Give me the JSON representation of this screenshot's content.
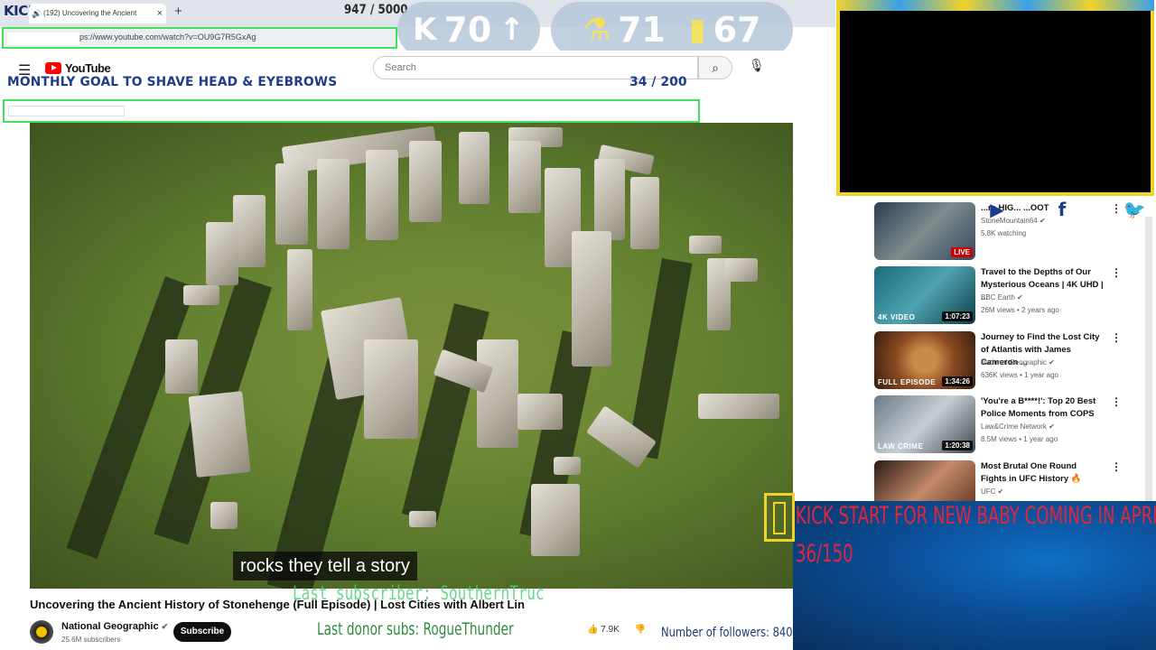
{
  "browser": {
    "overlay_logo": "KICKS",
    "tab_title": "(192) Uncovering the Ancient",
    "kick_progress": "947 / 5000",
    "url": "ps://www.youtube.com/watch?v=OU9G7R5GxAg"
  },
  "stats": {
    "kicks": "70",
    "followers_stat": "71",
    "viewers_stat": "67"
  },
  "youtube": {
    "logo": "YouTube",
    "search_placeholder": "Search",
    "search_icon": "search-icon",
    "mic_icon": "mic-icon"
  },
  "goal": {
    "text": "MONTHLY GOAL TO SHAVE HEAD & EYEBROWS",
    "count": "34   / 200",
    "progress_fraction": 0.17
  },
  "video": {
    "caption": "rocks they tell a story",
    "title": "Uncovering the Ancient History of Stonehenge (Full Episode) | Lost Cities with Albert Lin",
    "channel": "National Geographic",
    "channel_subs": "25.6M subscribers",
    "subscribe": "Subscribe",
    "likes": "7.9K"
  },
  "overlay": {
    "last_subscriber": "Last subscriber: SouthernTruc",
    "last_donor": "Last donor subs: RogueThunder",
    "followers": "Number of followers: 840",
    "kick_start_title": "KICK START FOR NEW BABY COMING IN APRIL",
    "kick_start_count": "36/150"
  },
  "recommendations": [
    {
      "title": "...rs HIG... ...OOT",
      "channel": "StoneMountain64",
      "meta": "5.8K watching",
      "badge": "LIVE",
      "thumb_label": ""
    },
    {
      "title": "Travel to the Depths of Our Mysterious Oceans | 4K UHD | ...",
      "channel": "BBC Earth",
      "meta": "26M views • 2 years ago",
      "badge": "1:07:23",
      "thumb_label": "4K VIDEO"
    },
    {
      "title": "Journey to Find the Lost City of Atlantis with James Cameron ...",
      "channel": "National Geographic",
      "meta": "636K views • 1 year ago",
      "badge": "1:34:26",
      "thumb_label": "FULL EPISODE"
    },
    {
      "title": "'You're a B****!': Top 20 Best Police Moments from COPS",
      "channel": "Law&Crime Network",
      "meta": "8.5M views • 1 year ago",
      "badge": "1:20:38",
      "thumb_label": "LAW CRIME"
    },
    {
      "title": "Most Brutal One Round Fights in UFC History 🔥",
      "channel": "UFC",
      "meta": "",
      "badge": "",
      "thumb_label": ""
    }
  ],
  "colors": {
    "goal_text": "#1f3c8c",
    "kick_red": "#e3263d",
    "overlay_green": "#44e05a",
    "frame_yellow": "#f0d32a"
  }
}
